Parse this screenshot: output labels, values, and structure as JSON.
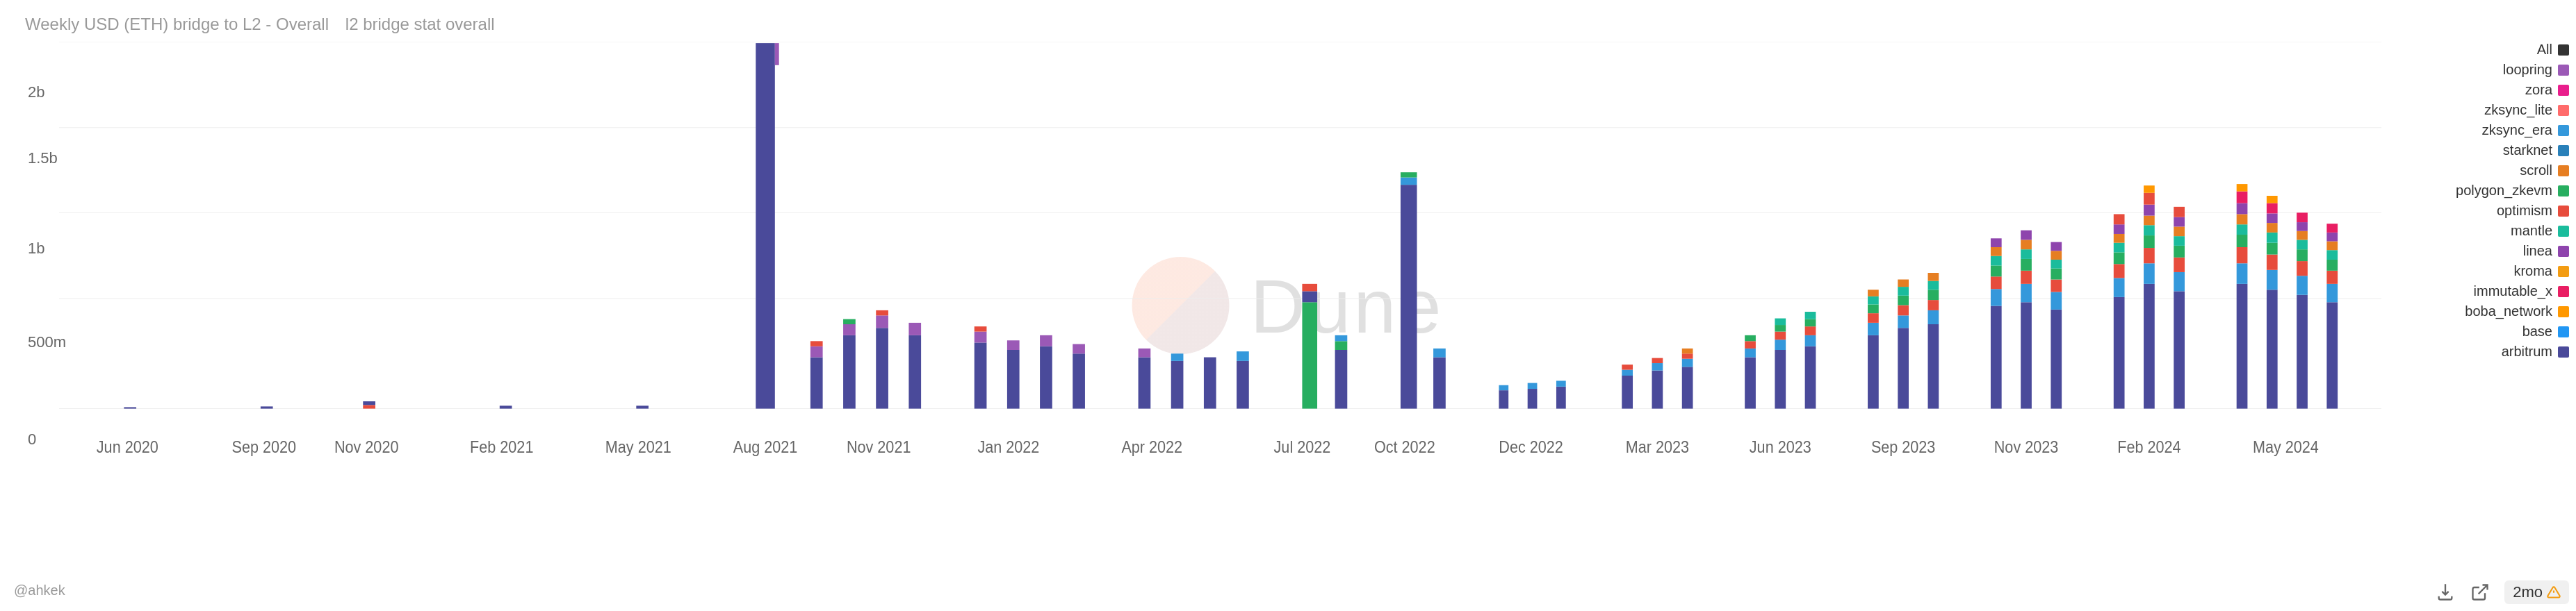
{
  "title": {
    "main": "Weekly USD (ETH) bridge to L2 - Overall",
    "sub": "l2 bridge stat overall"
  },
  "watermark": "Dune",
  "attribution": "@ahkek",
  "yAxis": {
    "labels": [
      "2b",
      "1.5b",
      "1b",
      "500m",
      "0"
    ]
  },
  "xAxis": {
    "labels": [
      "Jun 2020",
      "Sep 2020",
      "Nov 2020",
      "Feb 2021",
      "May 2021",
      "Aug 2021",
      "Nov 2021",
      "Jan 2022",
      "Apr 2022",
      "Jul 2022",
      "Oct 2022",
      "Dec 2022",
      "Mar 2023",
      "Jun 2023",
      "Sep 2023",
      "Nov 2023",
      "Feb 2024",
      "May 2024"
    ]
  },
  "legend": {
    "items": [
      {
        "label": "All",
        "color": "#333333"
      },
      {
        "label": "loopring",
        "color": "#9b59b6"
      },
      {
        "label": "zora",
        "color": "#e91e8c"
      },
      {
        "label": "zksync_lite",
        "color": "#ff6b6b"
      },
      {
        "label": "zksync_era",
        "color": "#3498db"
      },
      {
        "label": "starknet",
        "color": "#2980b9"
      },
      {
        "label": "scroll",
        "color": "#e67e22"
      },
      {
        "label": "polygon_zkevm",
        "color": "#27ae60"
      },
      {
        "label": "optimism",
        "color": "#e74c3c"
      },
      {
        "label": "mantle",
        "color": "#1abc9c"
      },
      {
        "label": "linea",
        "color": "#8e44ad"
      },
      {
        "label": "kroma",
        "color": "#f39c12"
      },
      {
        "label": "immutable_x",
        "color": "#e91e63"
      },
      {
        "label": "boba_network",
        "color": "#ff9800"
      },
      {
        "label": "base",
        "color": "#2196f3"
      },
      {
        "label": "arbitrum",
        "color": "#4a4a9a"
      }
    ]
  },
  "toolbar": {
    "time_label": "2mo",
    "download_icon": "⬇",
    "share_icon": "↗",
    "warning_icon": "⚠"
  }
}
